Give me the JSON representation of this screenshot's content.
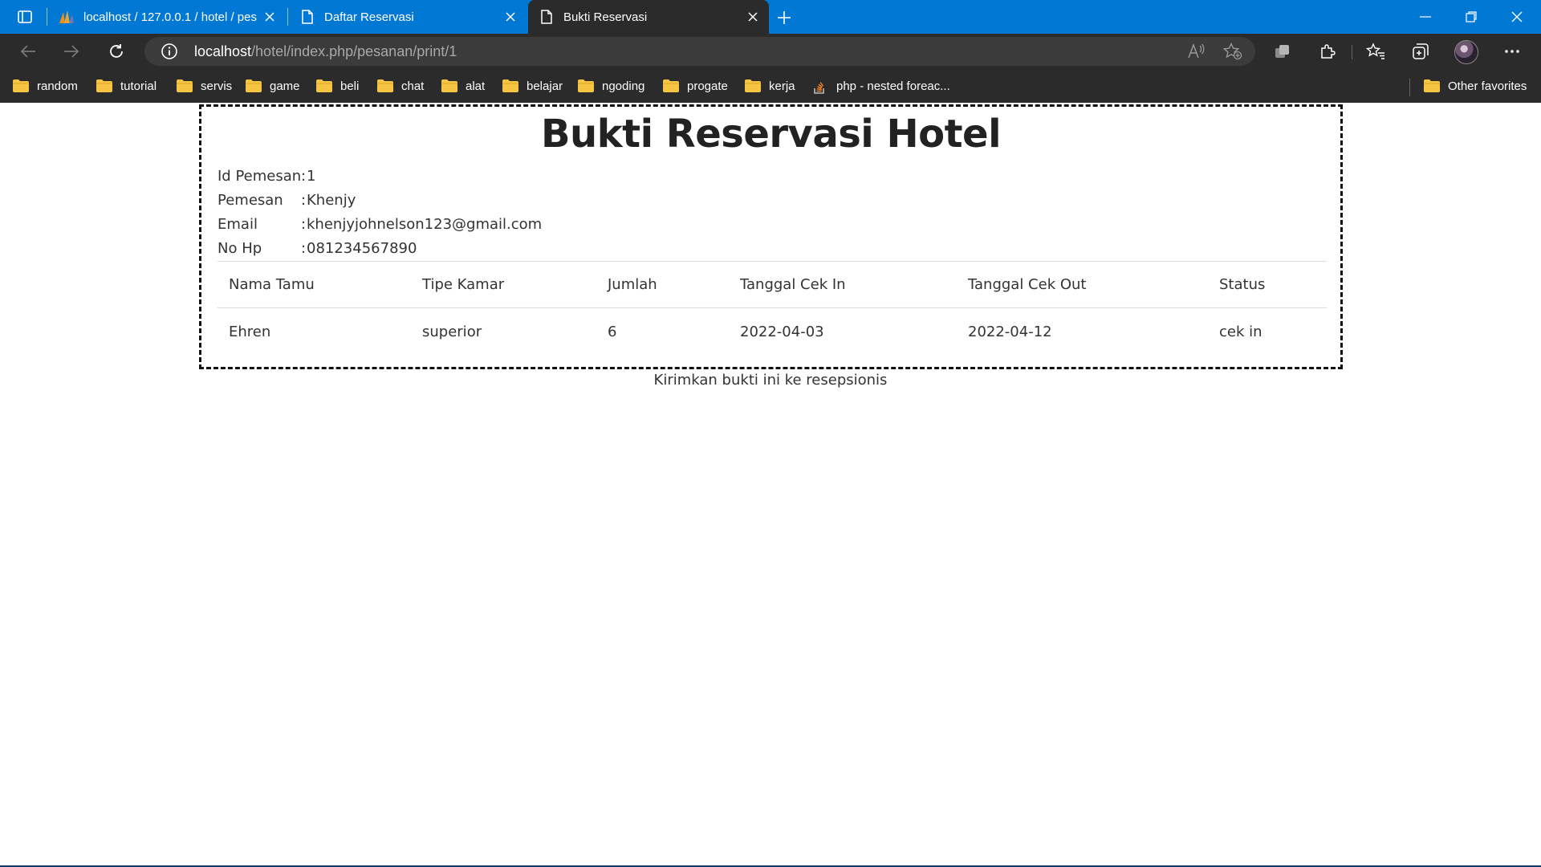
{
  "browser": {
    "tabs": [
      {
        "title": "localhost / 127.0.0.1 / hotel / pes",
        "favicon": "phpmyadmin-icon",
        "active": false
      },
      {
        "title": "Daftar Reservasi",
        "favicon": "page-icon",
        "active": false
      },
      {
        "title": "Bukti Reservasi",
        "favicon": "page-icon",
        "active": true
      }
    ],
    "url_host": "localhost",
    "url_path": "/hotel/index.php/pesanan/print/1",
    "favorites": [
      {
        "label": "random",
        "icon": "folder-icon"
      },
      {
        "label": "tutorial",
        "icon": "folder-icon"
      },
      {
        "label": "servis",
        "icon": "folder-icon"
      },
      {
        "label": "game",
        "icon": "folder-icon"
      },
      {
        "label": "beli",
        "icon": "folder-icon"
      },
      {
        "label": "chat",
        "icon": "folder-icon"
      },
      {
        "label": "alat",
        "icon": "folder-icon"
      },
      {
        "label": "belajar",
        "icon": "folder-icon"
      },
      {
        "label": "ngoding",
        "icon": "folder-icon"
      },
      {
        "label": "progate",
        "icon": "folder-icon"
      },
      {
        "label": "kerja",
        "icon": "folder-icon"
      },
      {
        "label": "php - nested foreac...",
        "icon": "stackoverflow-icon"
      }
    ],
    "other_favorites": "Other favorites",
    "colors": {
      "titlebar": "#0078d4",
      "toolbar": "#2b2b2b",
      "folder": "#f6c443"
    }
  },
  "receipt": {
    "title": "Bukti Reservasi Hotel",
    "info": [
      {
        "key": "Id Pemesan",
        "value": "1"
      },
      {
        "key": "Pemesan",
        "value": "Khenjy"
      },
      {
        "key": "Email",
        "value": "khenjyjohnelson123@gmail.com"
      },
      {
        "key": "No Hp",
        "value": "081234567890"
      }
    ],
    "columns": [
      "Nama Tamu",
      "Tipe Kamar",
      "Jumlah",
      "Tanggal Cek In",
      "Tanggal Cek Out",
      "Status"
    ],
    "rows": [
      [
        "Ehren",
        "superior",
        "6",
        "2022-04-03",
        "2022-04-12",
        "cek in"
      ]
    ]
  },
  "footer_note": "Kirimkan bukti ini ke resepsionis"
}
